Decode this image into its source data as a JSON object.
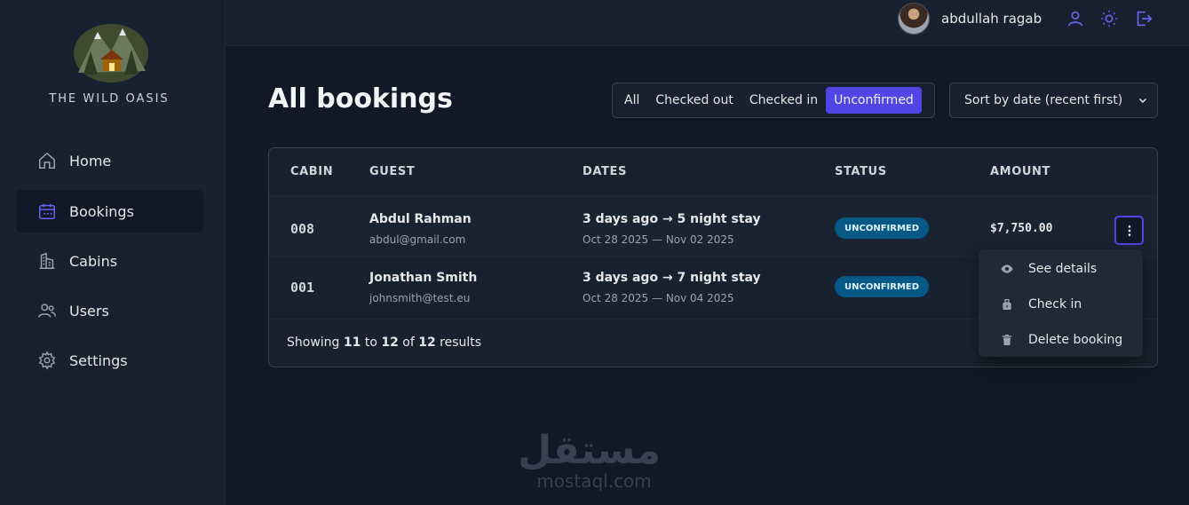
{
  "brand": {
    "name": "THE WILD OASIS"
  },
  "nav": [
    {
      "label": "Home",
      "icon": "home-icon"
    },
    {
      "label": "Bookings",
      "icon": "calendar-icon",
      "active": true
    },
    {
      "label": "Cabins",
      "icon": "buildings-icon"
    },
    {
      "label": "Users",
      "icon": "users-icon"
    },
    {
      "label": "Settings",
      "icon": "gear-icon"
    }
  ],
  "header": {
    "username": "abdullah ragab"
  },
  "page": {
    "title": "All bookings"
  },
  "filter": {
    "options": [
      "All",
      "Checked out",
      "Checked in",
      "Unconfirmed"
    ],
    "active": "Unconfirmed"
  },
  "sort": {
    "selected": "Sort by date (recent first)"
  },
  "table": {
    "headers": [
      "CABIN",
      "GUEST",
      "DATES",
      "STATUS",
      "AMOUNT"
    ],
    "rows": [
      {
        "cabin": "008",
        "guest_name": "Abdul Rahman",
        "guest_email": "abdul@gmail.com",
        "dates_main": "3 days ago → 5 night stay",
        "dates_sub": "Oct 28 2025 — Nov 02 2025",
        "status": "UNCONFIRMED",
        "amount": "$7,750.00"
      },
      {
        "cabin": "001",
        "guest_name": "Jonathan Smith",
        "guest_email": "johnsmith@test.eu",
        "dates_main": "3 days ago → 7 night stay",
        "dates_sub": "Oct 28 2025 — Nov 04 2025",
        "status": "UNCONFIRMED",
        "amount": ""
      }
    ],
    "footer": {
      "prefix": "Showing",
      "from": "11",
      "to_word": "to",
      "to": "12",
      "of_word": "of",
      "total": "12",
      "suffix": "results"
    }
  },
  "menu": {
    "items": [
      {
        "label": "See details",
        "icon": "eye-icon"
      },
      {
        "label": "Check in",
        "icon": "check-in-icon"
      },
      {
        "label": "Delete booking",
        "icon": "trash-icon"
      }
    ]
  },
  "watermark": {
    "arabic": "مستقل",
    "latin": "mostaql.com"
  },
  "colors": {
    "accent": "#4f46e5",
    "badge": "#075985",
    "background": "#111827",
    "panel": "#18212f"
  }
}
